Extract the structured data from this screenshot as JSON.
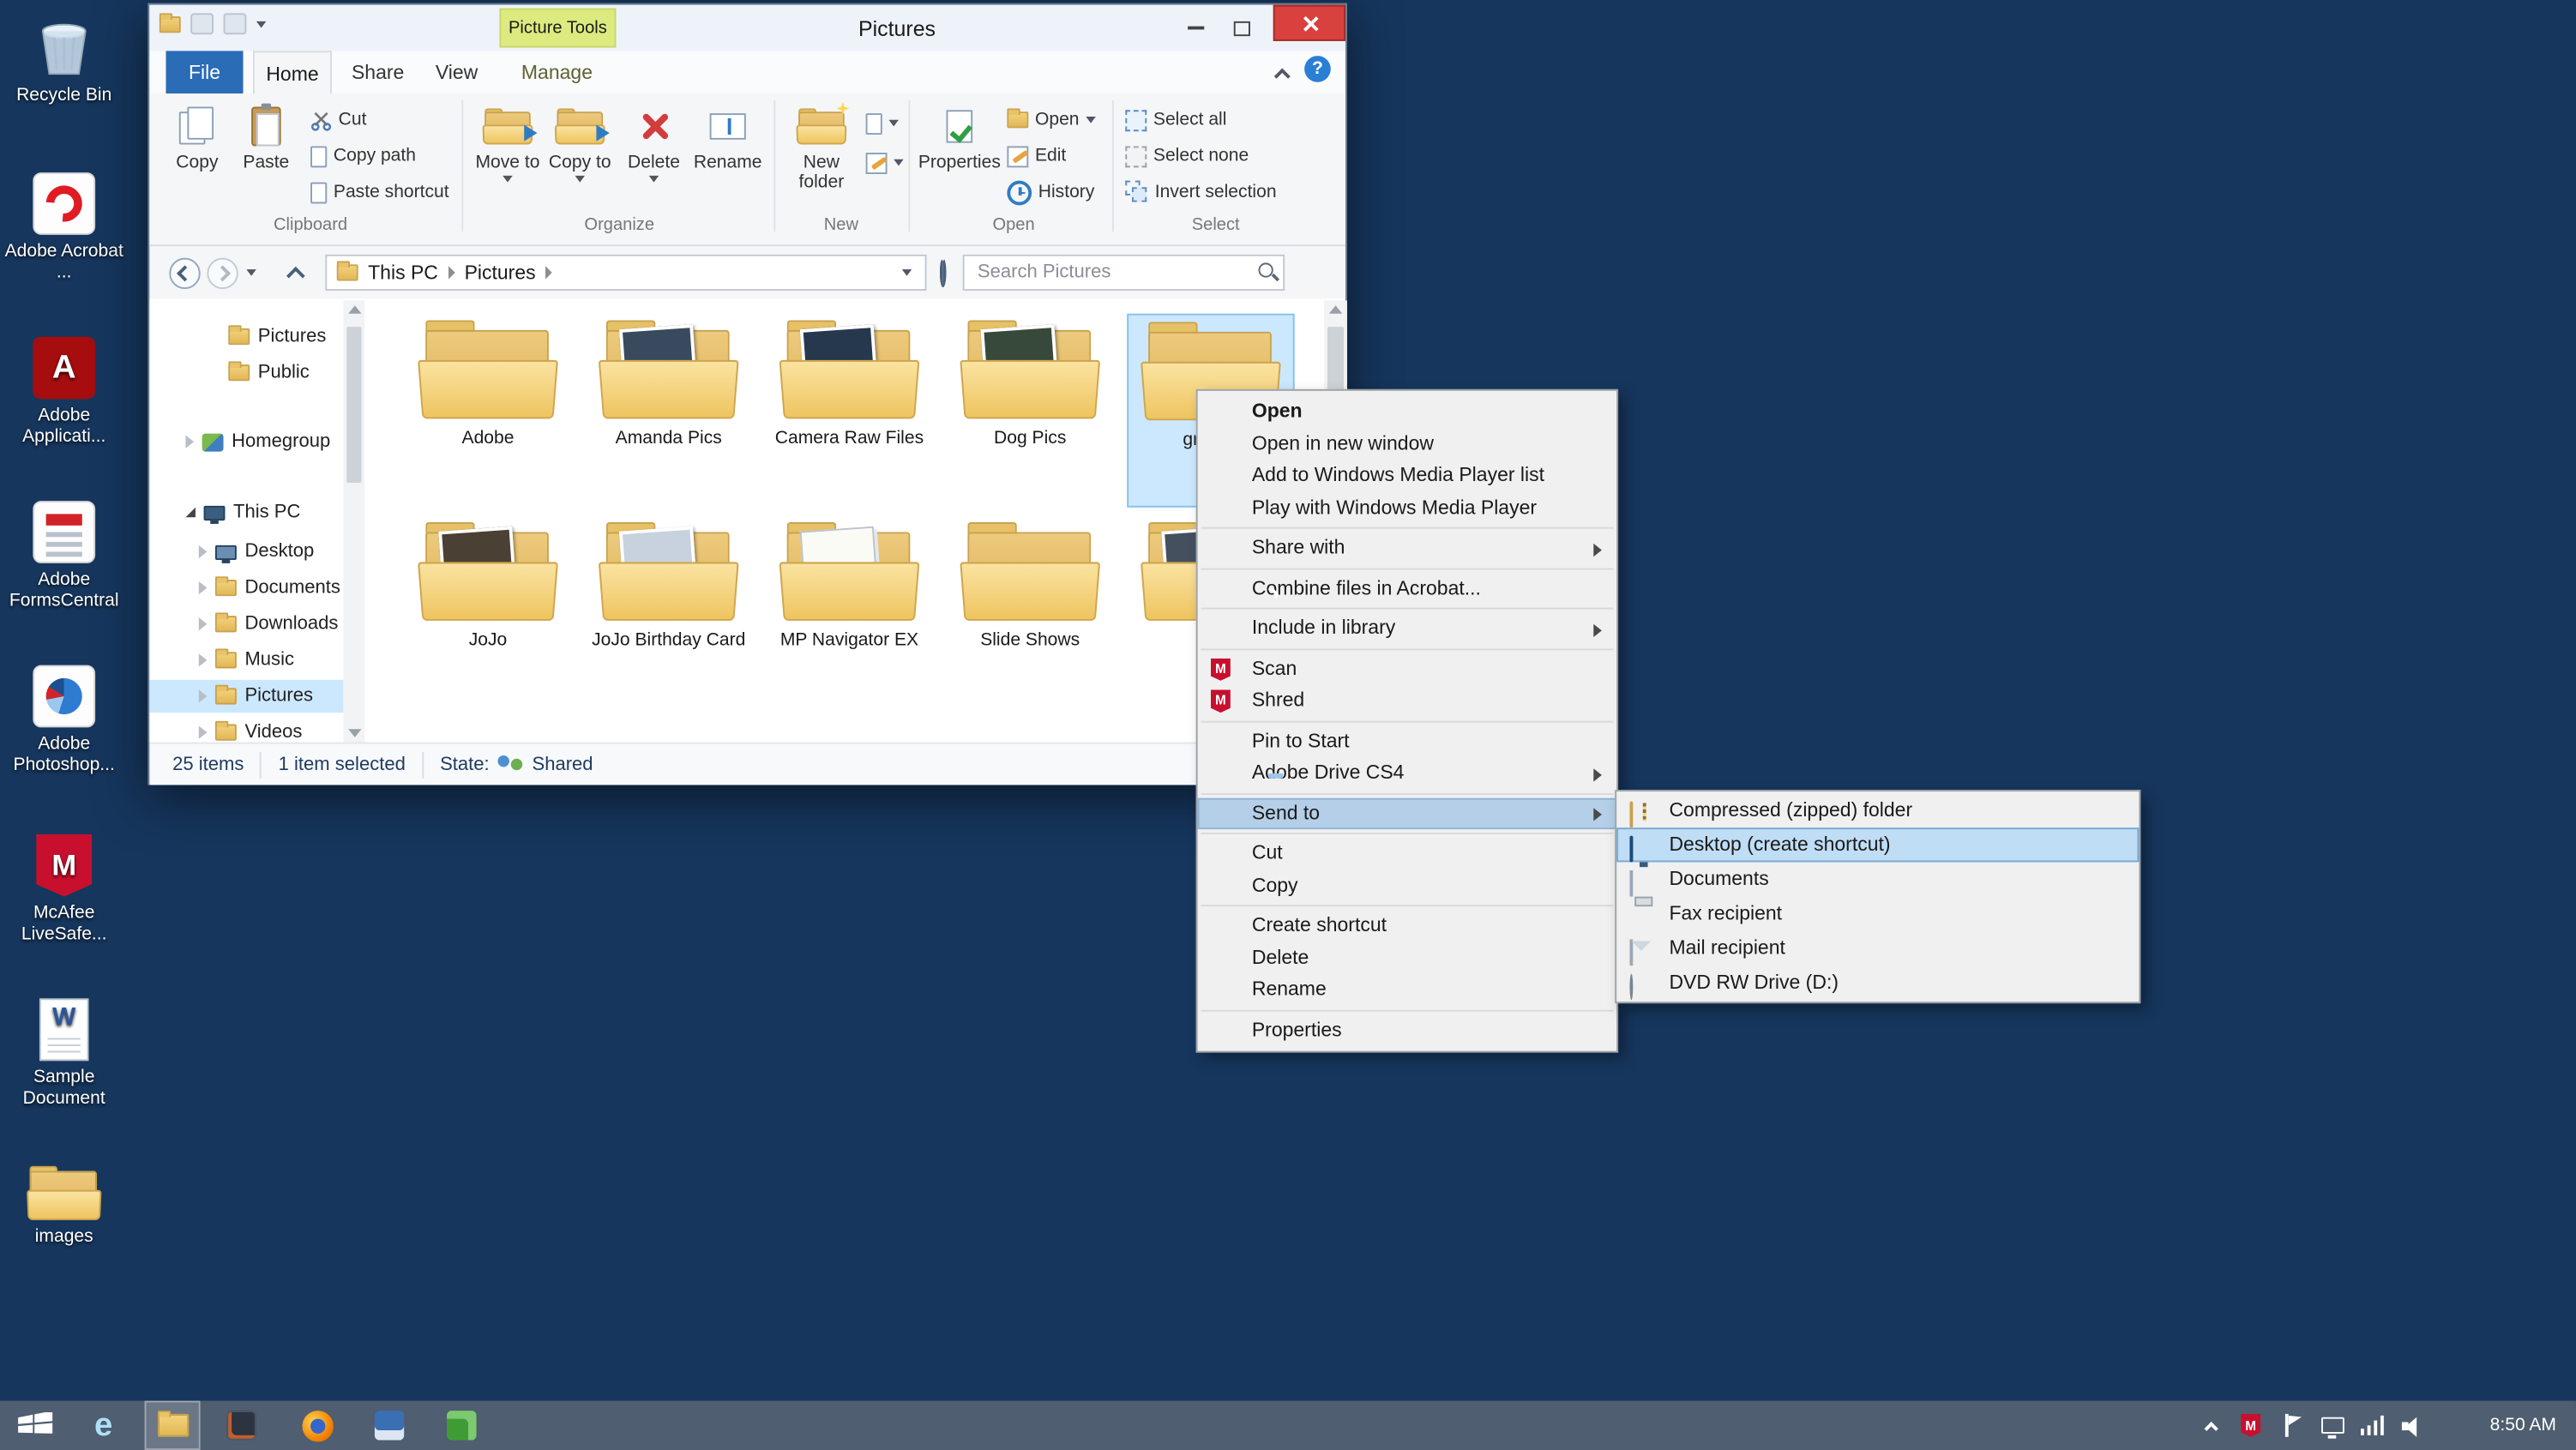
{
  "glyphs": {
    "ie": "e",
    "help": "?",
    "word": "W",
    "mcafee": "M",
    "adobe": "A"
  },
  "colors": {
    "desktop": "#16365d",
    "taskbar": "#4f5e70",
    "selection": "#cce8ff",
    "close_button": "#d8413d",
    "contextual_tab": "#dcea80",
    "file_tab": "#2a6cb5",
    "menu_highlight": "#b4cfe7"
  },
  "desktop": {
    "icons": [
      {
        "label": "Recycle Bin"
      },
      {
        "label": "Adobe Acrobat ..."
      },
      {
        "label": "Adobe Applicati..."
      },
      {
        "label": "Adobe FormsCentral"
      },
      {
        "label": "Adobe Photoshop..."
      },
      {
        "label": "McAfee LiveSafe..."
      },
      {
        "label": "Sample Document"
      },
      {
        "label": "images"
      }
    ]
  },
  "explorer": {
    "title": "Pictures",
    "contextual_tab": "Picture Tools",
    "tabs": {
      "file": "File",
      "home": "Home",
      "share": "Share",
      "view": "View",
      "manage": "Manage"
    },
    "ribbon": {
      "copy": "Copy",
      "paste": "Paste",
      "cut": "Cut",
      "copy_path": "Copy path",
      "paste_shortcut": "Paste shortcut",
      "clipboard_group": "Clipboard",
      "move_to": "Move to",
      "copy_to": "Copy to",
      "delete": "Delete",
      "rename": "Rename",
      "organize_group": "Organize",
      "new_folder": "New folder",
      "new_group": "New",
      "properties": "Properties",
      "open": "Open",
      "edit": "Edit",
      "history": "History",
      "open_group": "Open",
      "select_all": "Select all",
      "select_none": "Select none",
      "invert_selection": "Invert selection",
      "select_group": "Select"
    },
    "address": {
      "crumb_root": "This PC",
      "crumb_current": "Pictures",
      "search_placeholder": "Search Pictures"
    },
    "nav": {
      "items": [
        {
          "label": "Pictures"
        },
        {
          "label": "Public"
        },
        {
          "label": "Homegroup"
        },
        {
          "label": "This PC"
        },
        {
          "label": "Desktop"
        },
        {
          "label": "Documents"
        },
        {
          "label": "Downloads"
        },
        {
          "label": "Music"
        },
        {
          "label": "Pictures"
        },
        {
          "label": "Videos"
        }
      ]
    },
    "folders": [
      {
        "label": "Adobe"
      },
      {
        "label": "Amanda Pics"
      },
      {
        "label": "Camera Raw Files"
      },
      {
        "label": "Dog Pics"
      },
      {
        "label": "gr"
      },
      {
        "label": "JoJo"
      },
      {
        "label": "JoJo Birthday Card"
      },
      {
        "label": "MP Navigator EX"
      },
      {
        "label": "Slide Shows"
      },
      {
        "label": ""
      }
    ],
    "status": {
      "items_count": "25 items",
      "selected_count": "1 item selected",
      "state_label": "State:",
      "state_value": "Shared"
    }
  },
  "context_menu": {
    "open": "Open",
    "open_new_window": "Open in new window",
    "add_wmp": "Add to Windows Media Player list",
    "play_wmp": "Play with Windows Media Player",
    "share_with": "Share with",
    "combine_acrobat": "Combine files in Acrobat...",
    "include_library": "Include in library",
    "scan": "Scan",
    "shred": "Shred",
    "pin_start": "Pin to Start",
    "adobe_drive": "Adobe Drive CS4",
    "send_to": "Send to",
    "cut": "Cut",
    "copy": "Copy",
    "create_shortcut": "Create shortcut",
    "delete": "Delete",
    "rename": "Rename",
    "properties": "Properties"
  },
  "send_to_menu": {
    "zip": "Compressed (zipped) folder",
    "desktop": "Desktop (create shortcut)",
    "documents": "Documents",
    "fax": "Fax recipient",
    "mail": "Mail recipient",
    "dvd": "DVD RW Drive (D:)"
  },
  "taskbar": {
    "time": "8:50 AM"
  }
}
